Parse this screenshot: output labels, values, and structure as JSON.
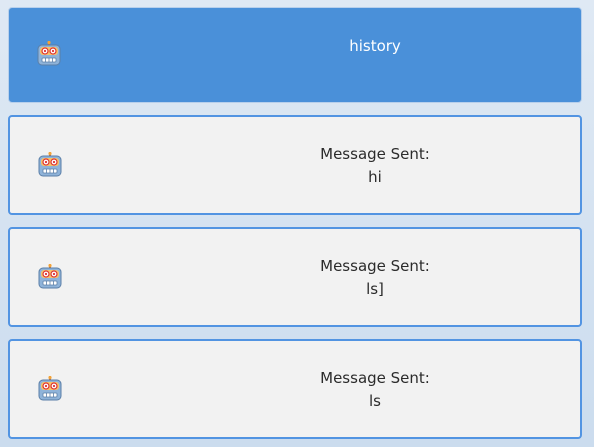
{
  "header": {
    "icon": "robot-icon",
    "title": "history"
  },
  "messages": [
    {
      "label": "Message Sent:",
      "text": "hi",
      "icon": "robot-icon"
    },
    {
      "label": "Message Sent:",
      "text": "ls]",
      "icon": "robot-icon"
    },
    {
      "label": "Message Sent:",
      "text": "ls",
      "icon": "robot-icon"
    }
  ],
  "colors": {
    "header_bg": "#4a90d9",
    "card_bg": "#f2f2f2",
    "card_border": "#5294e2"
  }
}
